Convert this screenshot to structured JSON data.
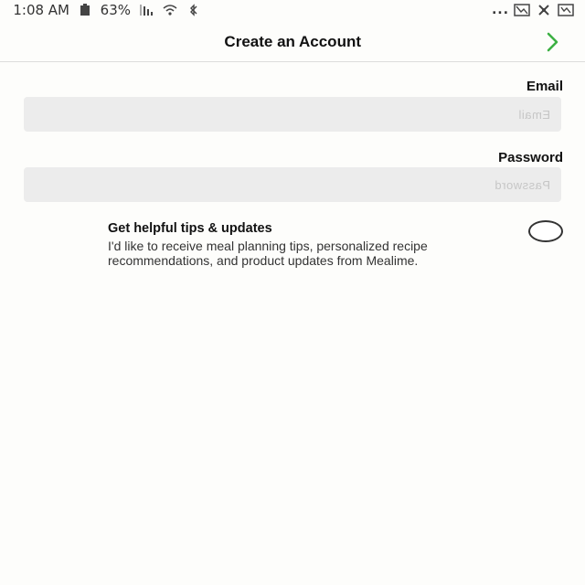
{
  "status_bar": {
    "time": "1:08 AM",
    "battery": "63%",
    "more": "..."
  },
  "header": {
    "title": "Create an Account"
  },
  "form": {
    "email": {
      "label": "Email",
      "placeholder": "Email",
      "value": ""
    },
    "password": {
      "label": "Password",
      "placeholder": "Password",
      "value": ""
    }
  },
  "optin": {
    "title": "Get helpful tips & updates",
    "description": "I'd like to receive meal planning tips, personalized recipe recommendations, and product updates from Mealime.",
    "checked": false
  },
  "colors": {
    "accent": "#3cb043",
    "input_bg": "#ececec",
    "background": "#fdfdfb"
  }
}
